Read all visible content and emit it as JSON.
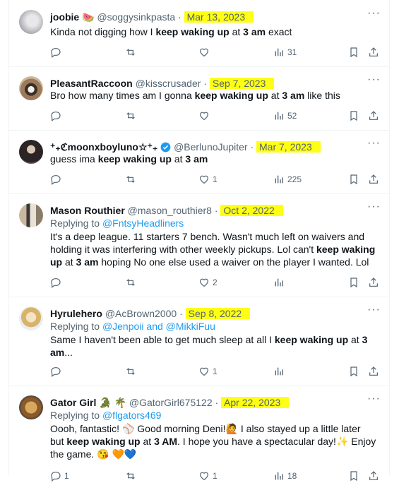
{
  "tweets": [
    {
      "name": "joobie 🍉",
      "handle": "@soggysinkpasta",
      "date": "Mar 13, 2023",
      "replying_label": "",
      "replying_to": "",
      "text_parts": [
        "Kinda not digging how I ",
        "keep waking up",
        " at ",
        "3 am",
        " exact"
      ],
      "reply_count": "",
      "like_count": "",
      "views": "31"
    },
    {
      "name": "PleasantRaccoon",
      "handle": "@kisscrusader",
      "date": "Sep 7, 2023",
      "replying_label": "",
      "replying_to": "",
      "text_parts": [
        "Bro how many times am I gonna ",
        "keep waking up",
        " at ",
        "3 am",
        " like this"
      ],
      "reply_count": "",
      "like_count": "",
      "views": "52"
    },
    {
      "name": "⁺₊ℭmoonxboyluno☆⁺₊",
      "handle": "@BerlunoJupiter",
      "date": "Mar 7, 2023",
      "replying_label": "",
      "replying_to": "",
      "text_parts": [
        "guess ima ",
        "keep waking up",
        " at ",
        "3 am",
        ""
      ],
      "reply_count": "",
      "like_count": "1",
      "views": "225"
    },
    {
      "name": "Mason Routhier",
      "handle": "@mason_routhier8",
      "date": "Oct 2, 2022",
      "replying_label": "Replying to",
      "replying_to": "@FntsyHeadliners",
      "text_parts": [
        "It's a deep league. 11 starters 7 bench. Wasn't much left on waivers and holding it was interfering with other weekly pickups. Lol can't ",
        "keep waking up",
        " at ",
        "3 am",
        " hoping No one else used a waiver on the player I wanted. Lol"
      ],
      "reply_count": "",
      "like_count": "2",
      "views": ""
    },
    {
      "name": "Hyrulehero",
      "handle": "@AcBrown2000",
      "date": "Sep 8, 2022",
      "replying_label": "Replying to",
      "replying_to": "@Jenpoii and @MikkiFuu",
      "text_parts": [
        "Same I haven't been able to get much sleep at all I ",
        "keep waking up",
        " at ",
        "3 am",
        "..."
      ],
      "reply_count": "",
      "like_count": "1",
      "views": ""
    },
    {
      "name": "Gator Girl 🐊 🌴",
      "handle": "@GatorGirl675122",
      "date": "Apr 22, 2023",
      "replying_label": "Replying to",
      "replying_to": "@flgators469",
      "text_parts": [
        "Oooh, fantastic! ⚾ Good morning Deni!🙋 I also stayed up a little later but ",
        "keep waking up",
        " at ",
        "3 AM",
        ". I hope you have a spectacular day!✨ Enjoy the game. 😘 🧡💙"
      ],
      "reply_count": "1",
      "like_count": "1",
      "views": "18"
    }
  ],
  "more_label": "···"
}
